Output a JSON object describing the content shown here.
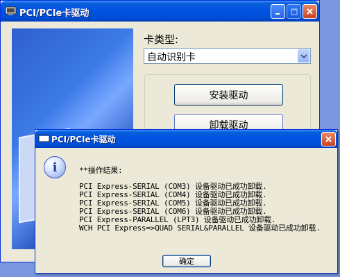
{
  "main_window": {
    "title": "PCI/PCIe卡驱动",
    "card_type_label": "卡类型:",
    "card_type_value": "自动识别卡",
    "install_button": "安装驱动",
    "uninstall_button": "卸载驱动"
  },
  "dialog": {
    "title": "PCI/PCIe卡驱动",
    "heading": "**操作结果:",
    "lines": [
      "PCI Express-SERIAL (COM3) 设备驱动已成功卸载.",
      "PCI Express-SERIAL (COM4) 设备驱动已成功卸载.",
      "PCI Express-SERIAL (COM5) 设备驱动已成功卸载.",
      "PCI Express-SERIAL (COM6) 设备驱动已成功卸载.",
      "PCI Express-PARALLEL (LPT3) 设备驱动已成功卸载.",
      "WCH PCI Express=>QUAD SERIAL&PARALLEL 设备驱动已成功卸载."
    ],
    "ok_button": "确定"
  },
  "colors": {
    "titlebar_blue": "#0054e3",
    "window_face": "#ece9d8",
    "close_red": "#c84420"
  },
  "icons": {
    "app": "app-window-icon",
    "minimize": "minimize-icon",
    "maximize": "maximize-icon",
    "close": "close-icon",
    "dropdown": "chevron-down-icon",
    "info": "info-icon"
  }
}
